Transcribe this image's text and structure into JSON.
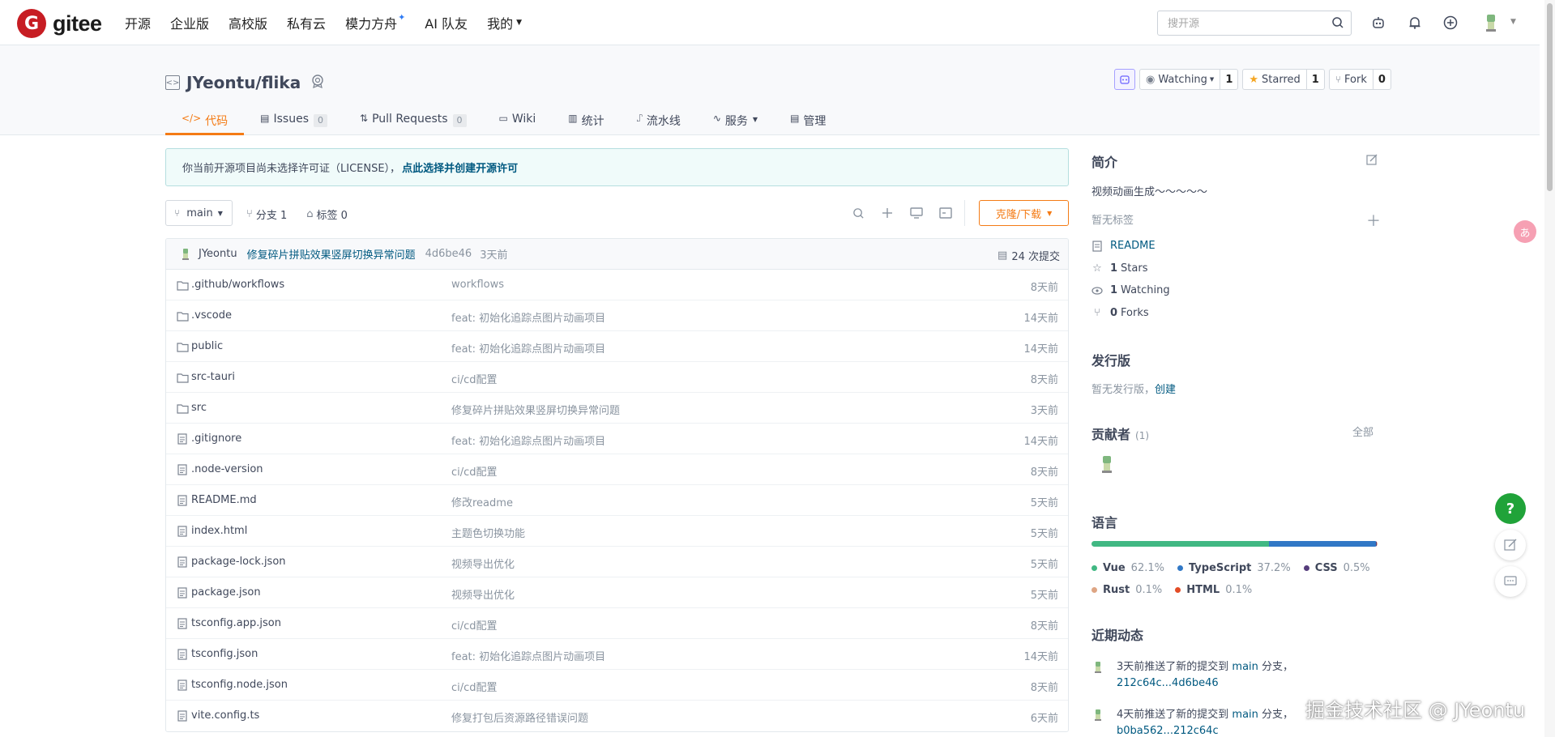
{
  "colors": {
    "brand": "#c71d23",
    "accent": "#f47b15",
    "link": "#005980",
    "help": "#20a339"
  },
  "topnav": {
    "logo_mark": "G",
    "logo_text": "gitee",
    "items": [
      {
        "label": "开源"
      },
      {
        "label": "企业版"
      },
      {
        "label": "高校版"
      },
      {
        "label": "私有云"
      },
      {
        "label": "模力方舟"
      },
      {
        "label": "AI 队友"
      },
      {
        "label": "我的"
      }
    ],
    "search_placeholder": "搜开源",
    "icons": [
      "robot-icon",
      "bell-icon",
      "plus-circle-icon",
      "avatar",
      "chevron-down-icon"
    ]
  },
  "repo": {
    "name": "JYeontu/flika",
    "watch_label": "Watching",
    "watch_count": "1",
    "star_label": "Starred",
    "star_count": "1",
    "fork_label": "Fork",
    "fork_count": "0",
    "tabs": [
      {
        "label": "代码",
        "icon": "code-icon"
      },
      {
        "label": "Issues",
        "count": "0",
        "icon": "issues-icon"
      },
      {
        "label": "Pull Requests",
        "count": "0",
        "icon": "pull-request-icon"
      },
      {
        "label": "Wiki",
        "icon": "wiki-icon"
      },
      {
        "label": "统计",
        "icon": "chart-icon"
      },
      {
        "label": "流水线",
        "icon": "pipeline-icon"
      },
      {
        "label": "服务",
        "icon": "service-icon"
      },
      {
        "label": "管理",
        "icon": "manage-icon"
      }
    ]
  },
  "license": {
    "text": "你当前开源项目尚未选择许可证（LICENSE），",
    "link": "点此选择并创建开源许可"
  },
  "branch": {
    "current": "main",
    "branches_label": "分支 1",
    "tags_label": "标签 0",
    "clone_label": "克隆/下载"
  },
  "commit": {
    "author": "JYeontu",
    "message": "修复碎片拼贴效果竖屏切换异常问题",
    "sha": "4d6be46",
    "time": "3天前",
    "count_label": "24 次提交"
  },
  "files": [
    {
      "type": "dir",
      "name": ".github/workflows",
      "message": "workflows",
      "time": "8天前"
    },
    {
      "type": "dir",
      "name": ".vscode",
      "message": "feat: 初始化追踪点图片动画项目",
      "time": "14天前"
    },
    {
      "type": "dir",
      "name": "public",
      "message": "feat: 初始化追踪点图片动画项目",
      "time": "14天前"
    },
    {
      "type": "dir",
      "name": "src-tauri",
      "message": "ci/cd配置",
      "time": "8天前"
    },
    {
      "type": "dir",
      "name": "src",
      "message": "修复碎片拼贴效果竖屏切换异常问题",
      "time": "3天前"
    },
    {
      "type": "file",
      "name": ".gitignore",
      "message": "feat: 初始化追踪点图片动画项目",
      "time": "14天前"
    },
    {
      "type": "file",
      "name": ".node-version",
      "message": "ci/cd配置",
      "time": "8天前"
    },
    {
      "type": "file",
      "name": "README.md",
      "message": "修改readme",
      "time": "5天前"
    },
    {
      "type": "file",
      "name": "index.html",
      "message": "主题色切换功能",
      "time": "5天前"
    },
    {
      "type": "file",
      "name": "package-lock.json",
      "message": "视频导出优化",
      "time": "5天前"
    },
    {
      "type": "file",
      "name": "package.json",
      "message": "视频导出优化",
      "time": "5天前"
    },
    {
      "type": "file",
      "name": "tsconfig.app.json",
      "message": "ci/cd配置",
      "time": "8天前"
    },
    {
      "type": "file",
      "name": "tsconfig.json",
      "message": "feat: 初始化追踪点图片动画项目",
      "time": "14天前"
    },
    {
      "type": "file",
      "name": "tsconfig.node.json",
      "message": "ci/cd配置",
      "time": "8天前"
    },
    {
      "type": "file",
      "name": "vite.config.ts",
      "message": "修复打包后资源路径错误问题",
      "time": "6天前"
    }
  ],
  "sidebar": {
    "intro_title": "简介",
    "intro_text": "视频动画生成～～～～～",
    "no_tags": "暂无标签",
    "readme": "README",
    "stars_count": "1",
    "stars_label": "Stars",
    "watching_count": "1",
    "watching_label": "Watching",
    "forks_count": "0",
    "forks_label": "Forks",
    "release_title": "发行版",
    "release_text": "暂无发行版，",
    "release_link": "创建",
    "contributors_title": "贡献者",
    "contributors_count": "(1)",
    "contributors_all": "全部",
    "languages_title": "语言",
    "languages": [
      {
        "name": "Vue",
        "percent": "62.1%",
        "value": 62.1,
        "color": "#41b883"
      },
      {
        "name": "TypeScript",
        "percent": "37.2%",
        "value": 37.2,
        "color": "#3178c6"
      },
      {
        "name": "CSS",
        "percent": "0.5%",
        "value": 0.5,
        "color": "#563d7c"
      },
      {
        "name": "Rust",
        "percent": "0.1%",
        "value": 0.1,
        "color": "#dea584"
      },
      {
        "name": "HTML",
        "percent": "0.1%",
        "value": 0.1,
        "color": "#e34c26"
      }
    ],
    "activity_title": "近期动态",
    "activities": [
      {
        "prefix": "3天前推送了新的提交到 ",
        "branch": "main",
        "mid": " 分支，",
        "range": "212c64c...4d6be46"
      },
      {
        "prefix": "4天前推送了新的提交到 ",
        "branch": "main",
        "mid": " 分支，",
        "range": "b0ba562...212c64c"
      }
    ]
  },
  "floating": {
    "help": "?",
    "translate": "あ"
  },
  "watermark": "掘金技术社区 @ JYeontu"
}
